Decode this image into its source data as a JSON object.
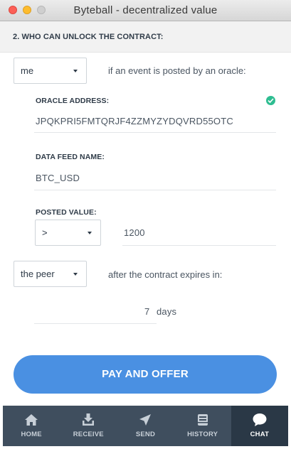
{
  "window": {
    "title": "Byteball - decentralized value"
  },
  "section": {
    "title": "2. WHO CAN UNLOCK THE CONTRACT:"
  },
  "condition1": {
    "party": "me",
    "text": "if an event is posted by an oracle:",
    "oracle_address_label": "ORACLE ADDRESS:",
    "oracle_address": "JPQKPRI5FMTQRJF4ZZMYZYDQVRD55OTC",
    "data_feed_label": "DATA FEED NAME:",
    "data_feed": "BTC_USD",
    "posted_value_label": "POSTED VALUE:",
    "comparison": ">",
    "posted_value": "1200"
  },
  "condition2": {
    "party": "the peer",
    "text": "after the contract expires in:",
    "expiry_value": "7",
    "expiry_unit": "days"
  },
  "pay_button": "PAY AND OFFER",
  "tabs": [
    {
      "label": "HOME",
      "icon": "home-icon"
    },
    {
      "label": "RECEIVE",
      "icon": "receive-icon"
    },
    {
      "label": "SEND",
      "icon": "send-icon"
    },
    {
      "label": "HISTORY",
      "icon": "history-icon"
    },
    {
      "label": "CHAT",
      "icon": "chat-icon"
    }
  ],
  "active_tab": "CHAT",
  "colors": {
    "accent": "#4a90e2",
    "tabbar": "#3f4e5e",
    "tab_active": "#2a3846",
    "verified": "#2ebd91"
  }
}
